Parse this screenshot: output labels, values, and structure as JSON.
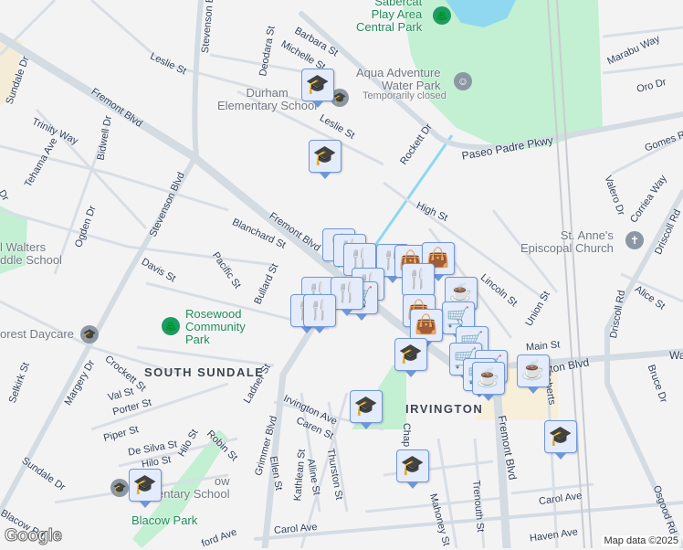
{
  "streets": [
    "Barbara St",
    "Michelle St",
    "Deodara St",
    "Leslie St",
    "Stevenson Blvd",
    "Fremont Blvd",
    "Trinity Way",
    "Bidwell Dr",
    "Tehama Ave",
    "Ogden Dr",
    "Stevenson Blvd",
    "Blanchard St",
    "Fremont Blvd",
    "Pacific St",
    "Davis St",
    "Bullard St",
    "Leslie St",
    "Rockett Dr",
    "Paseo Padre Pkwy",
    "High St",
    "Marabu Way",
    "Oro Dr",
    "Gomes Rd",
    "Valero Dr",
    "Corriea Way",
    "Driscoll Rd",
    "Lincoln St",
    "Union St",
    "Alice St",
    "Main St",
    "ton Blvd",
    "Driscoll Rd",
    "Bruce Dr",
    "Roberts",
    "Fremont Blvd",
    "Chap",
    "Mahoney St",
    "Trenouth St",
    "Carol Ave",
    "Haven Ave",
    "Osgood Rd",
    "Irvington Ave",
    "Caren St",
    "Thurston St",
    "Alline St",
    "Kathlean St",
    "Ellen St",
    "Grimmer Blvd",
    "Ladner St",
    "Robin St",
    "Hilo St",
    "De Silva St",
    "Hilo St",
    "Piper St",
    "Porter St",
    "Val St",
    "Crockett St",
    "Margery Dr",
    "Selkirk St",
    "Sundale Dr",
    "Blacow Rd",
    "Carol Ave",
    "ford Ave",
    "Sundale Dr",
    "Dr",
    "Wa"
  ],
  "places": {
    "durham": "Durham\nElementary School",
    "aqua": "Aqua Adventure\nWater Park",
    "aqua_status": "Temporarily closed",
    "church": "St. Anne's\nEpiscopal Church",
    "walters": "l Walters\nddle School",
    "daycare": "orest Daycare",
    "blacow_school": "ow\nentary School",
    "central_park": "Sabercat\nPlay Area\nCentral Park",
    "rosewood": "Rosewood\nCommunity\nPark",
    "blacow_park": "Blacow Park"
  },
  "areas": {
    "south_sundale": "SOUTH SUNDALE",
    "irvington": "IRVINGTON"
  },
  "attribution": {
    "logo": "Google",
    "map_data": "Map data ©2025"
  },
  "icons": {
    "school": "🎓",
    "restaurant": "🍴",
    "shopping": "👜",
    "grocery": "🛒",
    "coffee": "☕",
    "park": "🌲",
    "church": "✝"
  },
  "colors": {
    "marker_bg": "#e4ecfb",
    "marker_border": "#6f97d8",
    "marker_icon": "#0c3e63",
    "park": "#c3efd2",
    "water": "#8fd8ef",
    "road": "#d3dbe3"
  }
}
